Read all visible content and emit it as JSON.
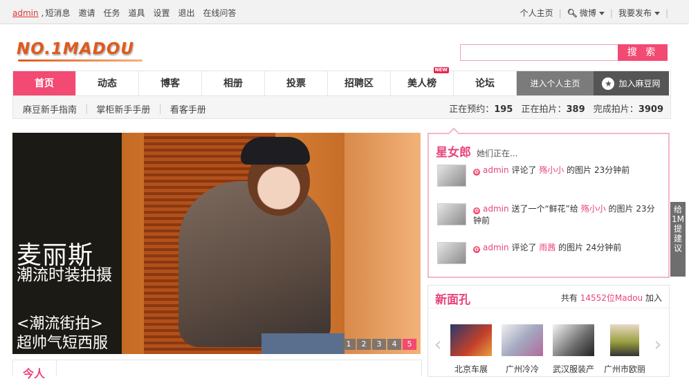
{
  "topbar": {
    "username": "admin",
    "comma": ",",
    "links": [
      "短消息",
      "邀请",
      "任务",
      "道具",
      "设置",
      "退出",
      "在线问答"
    ],
    "right": {
      "home": "个人主页",
      "weibo": "微博",
      "publish": "我要发布"
    }
  },
  "logo": {
    "text": "NO.1MADOU"
  },
  "search": {
    "placeholder": "",
    "button": "搜 索"
  },
  "nav": {
    "tabs": [
      "首页",
      "动态",
      "博客",
      "相册",
      "投票",
      "招聘区",
      "美人榜",
      "论坛"
    ],
    "active_index": 0,
    "new_badge": "NEW",
    "enter": "进入个人主页",
    "join": "加入麻豆网"
  },
  "subnav": {
    "links": [
      "麻豆新手指南",
      "掌柜新手手册",
      "看客手册"
    ],
    "stats": {
      "booking_label": "正在预约：",
      "booking_value": "195",
      "shooting_label": "正在拍片：",
      "shooting_value": "389",
      "done_label": "完成拍片：",
      "done_value": "3909"
    }
  },
  "banner": {
    "title": "麦丽斯",
    "subtitle": "潮流时装拍摄",
    "tag": "<潮流街拍>",
    "tag2": "超帅气短西服",
    "pages": [
      "1",
      "2",
      "3",
      "4",
      "5"
    ],
    "active_page": 5
  },
  "stars": {
    "title": "星女郎",
    "subtitle": "她们正在...",
    "items": [
      {
        "user": "admin",
        "action": "评论了",
        "object": "殇小小",
        "rest": "的图片 23分钟前"
      },
      {
        "user": "admin",
        "action": "送了一个“鲜花”给",
        "object": "殇小小",
        "rest": "的图片 23分钟前"
      },
      {
        "user": "admin",
        "action": "评论了",
        "object": "雨茜",
        "rest": "的图片 24分钟前"
      }
    ]
  },
  "sidetab": {
    "text": "给1M提建议"
  },
  "faces": {
    "title": "新面孔",
    "count_prefix": "共有",
    "count": "14552位Madou",
    "count_suffix": "加入",
    "items": [
      "北京车展",
      "广州冷冷",
      "武汉服装产",
      "广州市欧丽"
    ]
  },
  "bottom": {
    "label": "今人"
  },
  "colors": {
    "accent": "#f24a72",
    "pink_text": "#e8437a",
    "logo": "#e05a1c"
  }
}
